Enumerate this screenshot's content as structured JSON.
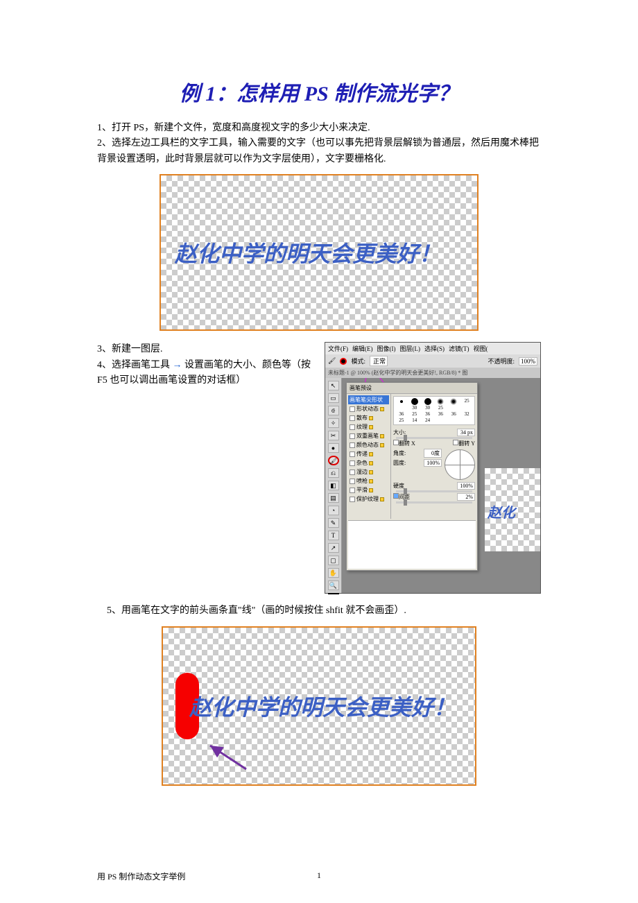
{
  "title": "例 1：怎样用 PS 制作流光字？",
  "steps": {
    "s1": "1、打开 PS，新建个文件，宽度和高度视文字的多少大小来决定.",
    "s2": "2、选择左边工具栏的文字工具，输入需要的文字（也可以事先把背景层解锁为普通层，然后用魔术棒把背景设置透明，此时背景层就可以作为文字层使用），文字要栅格化.",
    "s3": "3、新建一图层.",
    "s4a": "4、选择画笔工具",
    "s4b": "设置画笔的大小、颜色等（按 F5 也可以调出画笔设置的对话框）",
    "s5": "5、用画笔在文字的前头画条直\"线\"（画的时候按住 shfit 就不会画歪）."
  },
  "banner": "赵化中学的明天会更美好！",
  "arrow": "→",
  "ps": {
    "menus": [
      "文件(F)",
      "编辑(E)",
      "图像(I)",
      "图层(L)",
      "选择(S)",
      "滤镜(T)",
      "视图("
    ],
    "toolbar": {
      "mode_label": "模式:",
      "mode_value": "正常",
      "opacity_label": "不透明度:",
      "opacity_value": "100%"
    },
    "doc_title": "未标题-1 @ 100% (赵化中学的明天会更美好!, RGB/8) * 图",
    "panel_tab": "画笔预设",
    "panel_left": [
      "画笔笔尖形状",
      "形状动态",
      "散布",
      "纹理",
      "双重画笔",
      "颜色动态",
      "传递",
      "杂色",
      "湿边",
      "喷枪",
      "平滑",
      "保护纹理"
    ],
    "brush_sizes_r1": [
      "",
      "30",
      "30",
      "25",
      ""
    ],
    "brush_sizes_r2": [
      "25",
      "36",
      "25",
      "36",
      "36"
    ],
    "brush_sizes_r3": [
      "36",
      "32",
      "25",
      "14",
      "24"
    ],
    "fields": {
      "size_label": "大小:",
      "size_value": "34 px",
      "flipx": "翻转 X",
      "flipy": "翻转 Y",
      "angle_label": "角度:",
      "angle_value": "0度",
      "round_label": "圆度:",
      "round_value": "100%",
      "hard_label": "硬度",
      "hard_value": "100%",
      "spacing_label": "间距",
      "spacing_value": "2%"
    }
  },
  "strip_text": "赵化",
  "footer": {
    "left": "用 PS 制作动态文字举例",
    "page": "1"
  }
}
